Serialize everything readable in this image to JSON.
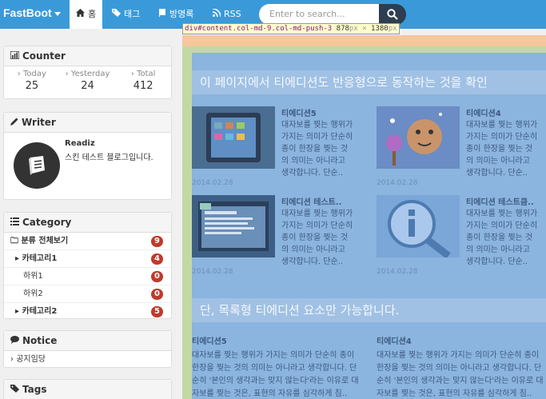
{
  "navbar": {
    "brand": "FastBoot",
    "items": [
      {
        "label": "홈",
        "icon": "home-icon",
        "active": true
      },
      {
        "label": "태그",
        "icon": "tag-icon"
      },
      {
        "label": "방명록",
        "icon": "book-icon"
      },
      {
        "label": "RSS",
        "icon": "rss-icon"
      }
    ],
    "search_placeholder": "Enter to search..."
  },
  "inspector": {
    "selector": "div#content.col-md-9.col-md-push-3",
    "width": "878",
    "height": "1380",
    "unit": "px",
    "times": "×"
  },
  "counter": {
    "title": "Counter",
    "today_label": "Today",
    "today": "25",
    "yesterday_label": "Yesterday",
    "yesterday": "24",
    "total_label": "Total",
    "total": "412"
  },
  "writer": {
    "title": "Writer",
    "name": "Readiz",
    "desc": "스킨 테스트 블로그입니다."
  },
  "category": {
    "title": "Category",
    "rows": [
      {
        "label": "분류 전체보기",
        "count": "9"
      },
      {
        "label": "카테고리1",
        "count": "4"
      },
      {
        "label": "하위1",
        "count": "0"
      },
      {
        "label": "하위2",
        "count": "0"
      },
      {
        "label": "카테고리2",
        "count": "5"
      }
    ]
  },
  "notice": {
    "title": "Notice",
    "item": "공지임당"
  },
  "tags": {
    "title": "Tags"
  },
  "main": {
    "section1_title": "이 페이지에서 티에디션도 반응형으로 동작하는 것을 확인",
    "section2_title": "단, 목록형 티에디션 요소만 가능합니다.",
    "cards": [
      {
        "title": "티에디션5",
        "body": "대자보를 찢는 행위가 가지는 의미가 단순히 종이 한장을 찢는 것의 의미는 아니라고 생각합니다. 단순..",
        "date": "2014.02.28"
      },
      {
        "title": "티에디션4",
        "body": "대자보를 찢는 행위가 가지는 의미가 단순히 종이 한장을 찢는 것의 의미는 아니라고 생각합니다. 단순..",
        "date": "2014.02.28"
      },
      {
        "title": "티에디션 테스트..",
        "body": "대자보를 찢는 행위가 가지는 의미가 단순히 종이 한장을 찢는 것의 의미는 아니라고 생각합니다. 단순..",
        "date": "2014.02.28"
      },
      {
        "title": "티에디션 테스트큼..",
        "body": "대자보를 찢는 행위가 가지는 의미가 단순히 종이 한장을 찢는 것의 의미는 아니라고 생각합니다. 단순..",
        "date": "2014.02.28"
      }
    ],
    "list": [
      {
        "title": "티에디션5",
        "body": "대자보를 찢는 행위가 가지는 의미가 단순히 종이 한장을 찢는 것의 의미는 아니라고 생각합니다. 단순히 '본인의 생각과는 맞지 않는다'라는 이유로 대자보를 찢는 것은, 표현의 자유를 심각하게 침.."
      },
      {
        "title": "티에디션4",
        "body": "대자보를 찢는 행위가 가지는 의미가 단순히 종이 한장을 찢는 것의 의미는 아니라고 생각합니다. 단순히 '본인의 생각과는 맞지 않는다'라는 이유로 대자보를 찢는 것은, 표현의 자유를 심각하게 침.."
      }
    ]
  }
}
